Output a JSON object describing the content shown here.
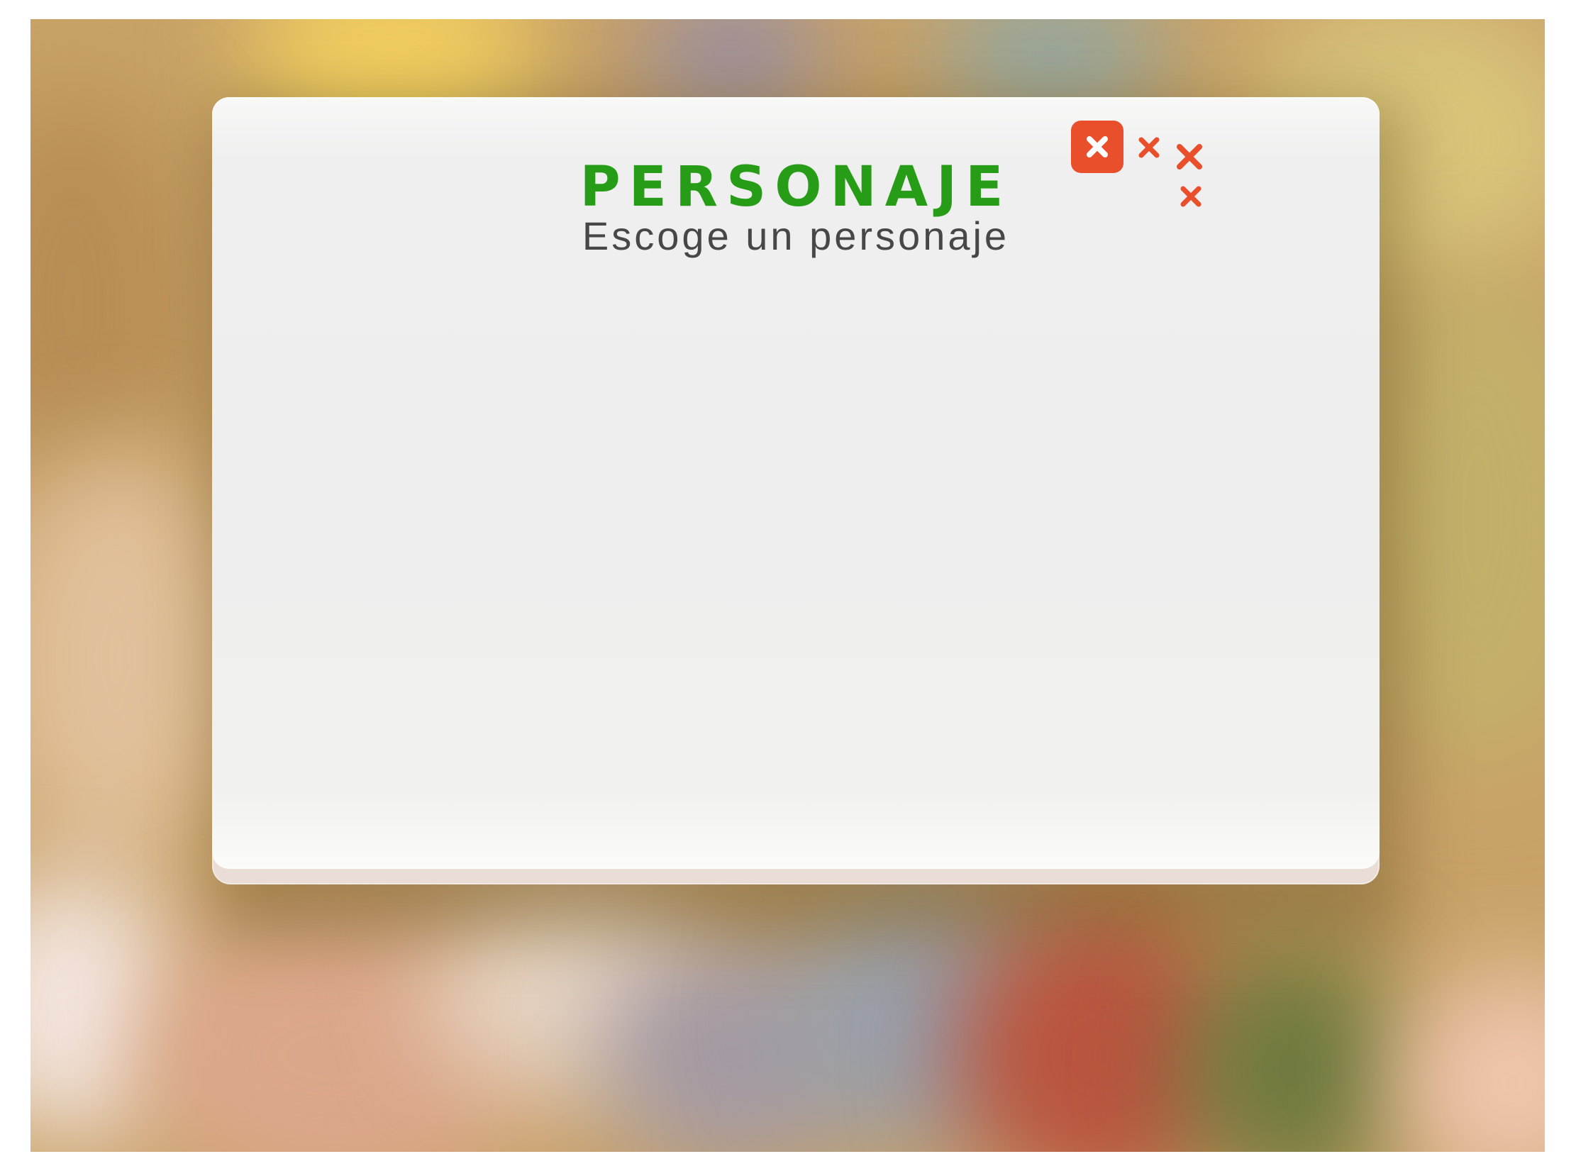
{
  "modal": {
    "title": "PERSONAJE",
    "subtitle": "Escoge un personaje",
    "close_icon": "close-icon",
    "decoration_icon": "x-mark-icon"
  },
  "colors": {
    "title_green": "#279c16",
    "accent_red": "#ea4f2c",
    "subtitle_gray": "#474747"
  }
}
